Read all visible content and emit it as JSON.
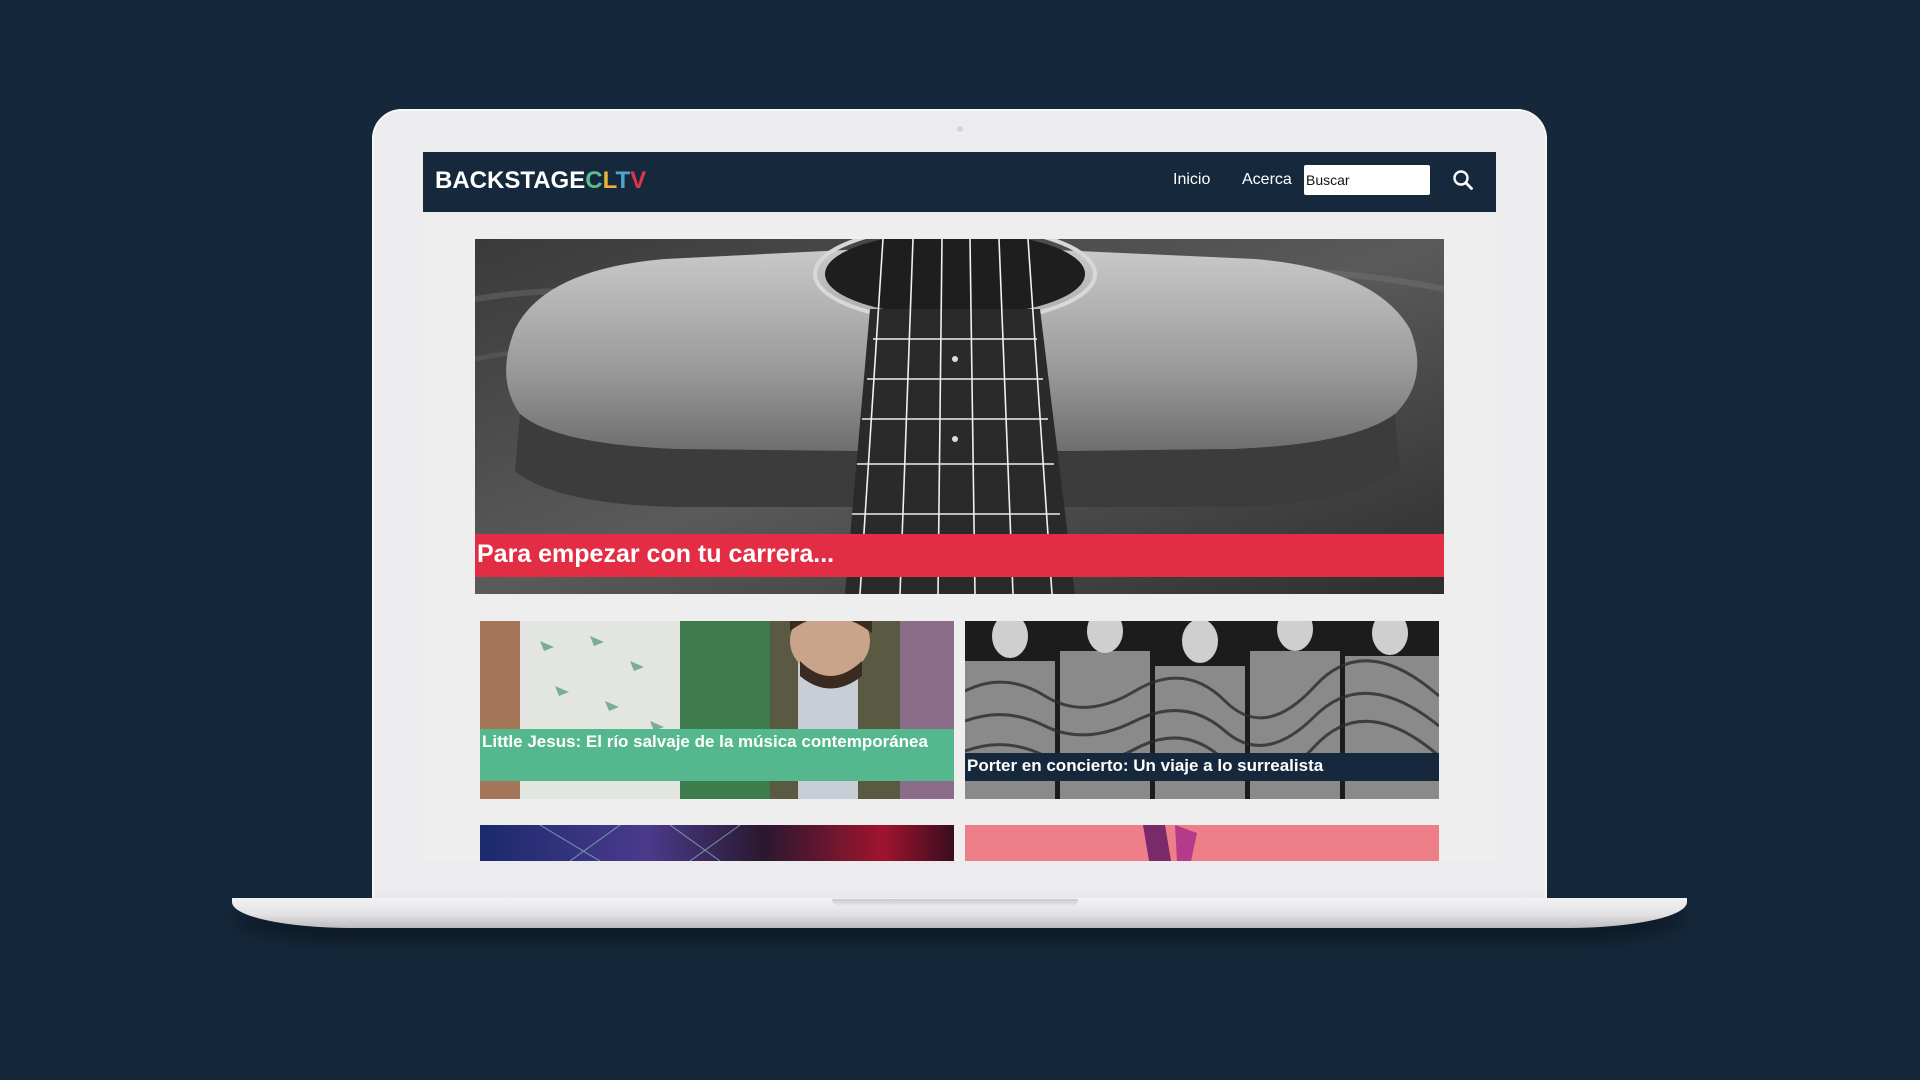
{
  "site": {
    "logo": {
      "primary": "BACKSTAGE",
      "accent_letters": [
        "C",
        "L",
        "T",
        "V"
      ]
    },
    "nav": {
      "links": [
        {
          "label": "Inicio"
        },
        {
          "label": "Acerca"
        }
      ],
      "search": {
        "placeholder": "Buscar",
        "icon": "search-icon"
      }
    }
  },
  "hero": {
    "caption": "Para empezar con tu carrera..."
  },
  "articles": [
    {
      "title": "Little Jesus: El río salvaje de la música contemporánea"
    },
    {
      "title": "Porter en concierto: Un viaje a lo surrealista"
    }
  ],
  "colors": {
    "background": "#15283b",
    "navbar": "#16283b",
    "hero_caption": "#e22d45",
    "card_green": "#55b78e",
    "logo_c": "#5dbb8f",
    "logo_l": "#e9b33a",
    "logo_t": "#4aa7cf",
    "logo_v": "#e4344a"
  }
}
